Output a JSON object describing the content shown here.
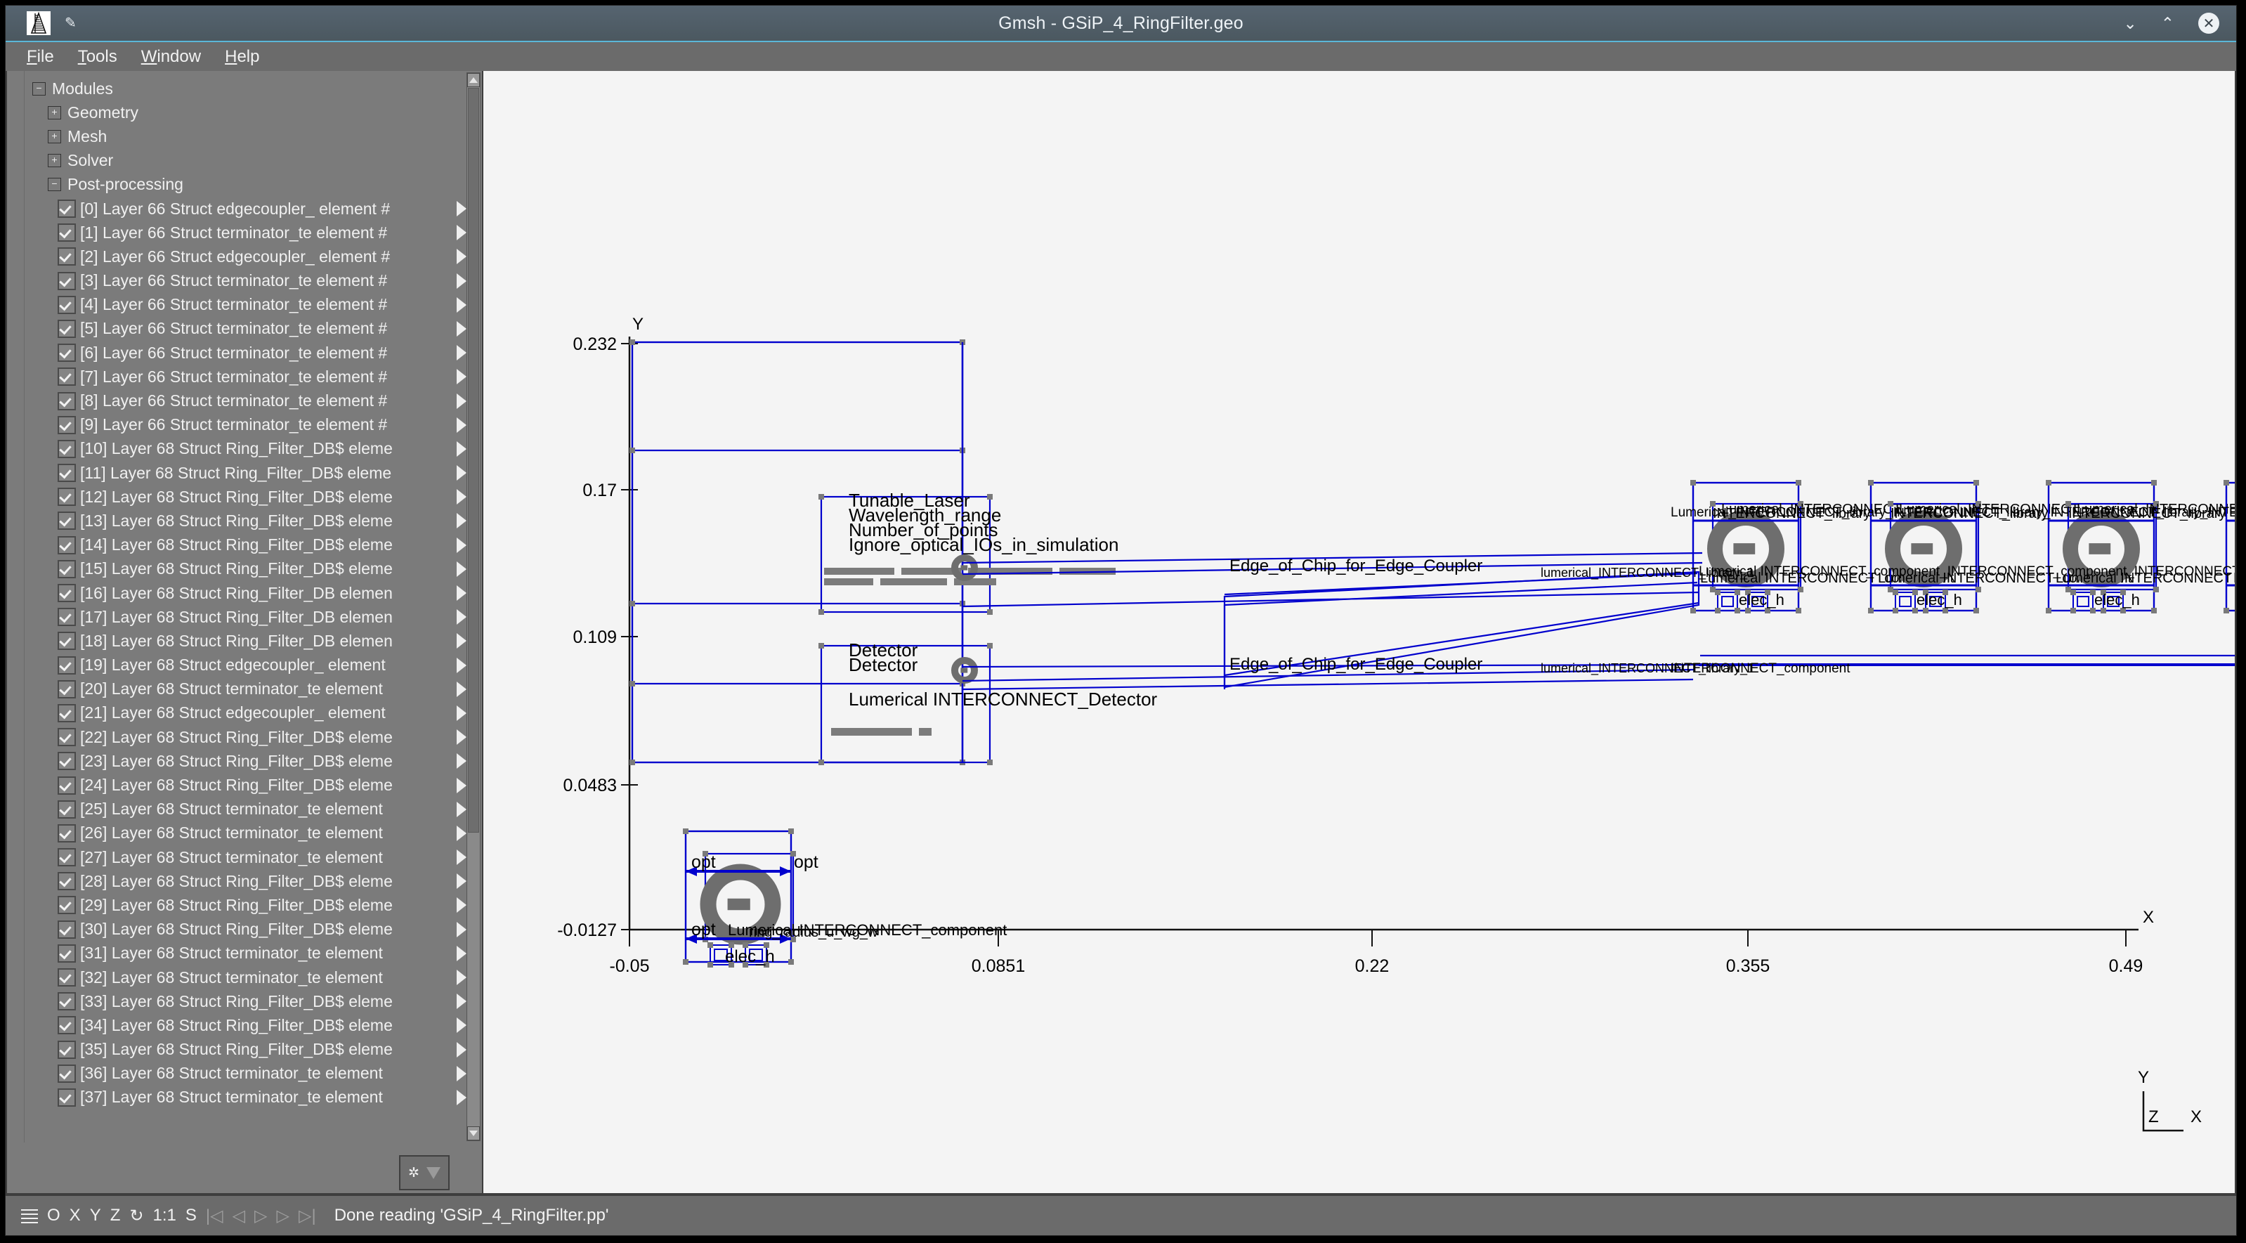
{
  "window": {
    "title": "Gmsh - GSiP_4_RingFilter.geo",
    "logo_icon": "gmsh-logo-icon",
    "pin_icon": "pin-icon",
    "minimize_icon": "chevron-down-icon",
    "maximize_icon": "chevron-up-icon",
    "close_icon": "close-icon",
    "accent_color": "#5bb6d8",
    "titlebar_color": "#4d5a63"
  },
  "menubar": {
    "items": [
      {
        "label": "File",
        "mnemonic": "F"
      },
      {
        "label": "Tools",
        "mnemonic": "T"
      },
      {
        "label": "Window",
        "mnemonic": "W"
      },
      {
        "label": "Help",
        "mnemonic": "H"
      }
    ]
  },
  "sidebar": {
    "root": {
      "label": "Modules",
      "expanded": true
    },
    "modules": [
      {
        "label": "Geometry",
        "expanded": false
      },
      {
        "label": "Mesh",
        "expanded": false
      },
      {
        "label": "Solver",
        "expanded": false
      },
      {
        "label": "Post-processing",
        "expanded": true
      }
    ],
    "views": [
      {
        "index": "[0]",
        "label": "[0] Layer 66 Struct edgecoupler_ element #",
        "checked": true
      },
      {
        "index": "[1]",
        "label": "[1] Layer 66 Struct terminator_te element #",
        "checked": true
      },
      {
        "index": "[2]",
        "label": "[2] Layer 66 Struct edgecoupler_ element #",
        "checked": true
      },
      {
        "index": "[3]",
        "label": "[3] Layer 66 Struct terminator_te element #",
        "checked": true
      },
      {
        "index": "[4]",
        "label": "[4] Layer 66 Struct terminator_te element #",
        "checked": true
      },
      {
        "index": "[5]",
        "label": "[5] Layer 66 Struct terminator_te element #",
        "checked": true
      },
      {
        "index": "[6]",
        "label": "[6] Layer 66 Struct terminator_te element #",
        "checked": true
      },
      {
        "index": "[7]",
        "label": "[7] Layer 66 Struct terminator_te element #",
        "checked": true
      },
      {
        "index": "[8]",
        "label": "[8] Layer 66 Struct terminator_te element #",
        "checked": true
      },
      {
        "index": "[9]",
        "label": "[9] Layer 66 Struct terminator_te element #",
        "checked": true
      },
      {
        "index": "[10]",
        "label": "[10] Layer 68 Struct Ring_Filter_DB$ eleme",
        "checked": true
      },
      {
        "index": "[11]",
        "label": "[11] Layer 68 Struct Ring_Filter_DB$ eleme",
        "checked": true
      },
      {
        "index": "[12]",
        "label": "[12] Layer 68 Struct Ring_Filter_DB$ eleme",
        "checked": true
      },
      {
        "index": "[13]",
        "label": "[13] Layer 68 Struct Ring_Filter_DB$ eleme",
        "checked": true
      },
      {
        "index": "[14]",
        "label": "[14] Layer 68 Struct Ring_Filter_DB$ eleme",
        "checked": true
      },
      {
        "index": "[15]",
        "label": "[15] Layer 68 Struct Ring_Filter_DB$ eleme",
        "checked": true
      },
      {
        "index": "[16]",
        "label": "[16] Layer 68 Struct Ring_Filter_DB elemen",
        "checked": true
      },
      {
        "index": "[17]",
        "label": "[17] Layer 68 Struct Ring_Filter_DB elemen",
        "checked": true
      },
      {
        "index": "[18]",
        "label": "[18] Layer 68 Struct Ring_Filter_DB elemen",
        "checked": true
      },
      {
        "index": "[19]",
        "label": "[19] Layer 68 Struct edgecoupler_ element",
        "checked": true
      },
      {
        "index": "[20]",
        "label": "[20] Layer 68 Struct terminator_te element",
        "checked": true
      },
      {
        "index": "[21]",
        "label": "[21] Layer 68 Struct edgecoupler_ element",
        "checked": true
      },
      {
        "index": "[22]",
        "label": "[22] Layer 68 Struct Ring_Filter_DB$ eleme",
        "checked": true
      },
      {
        "index": "[23]",
        "label": "[23] Layer 68 Struct Ring_Filter_DB$ eleme",
        "checked": true
      },
      {
        "index": "[24]",
        "label": "[24] Layer 68 Struct Ring_Filter_DB$ eleme",
        "checked": true
      },
      {
        "index": "[25]",
        "label": "[25] Layer 68 Struct terminator_te element",
        "checked": true
      },
      {
        "index": "[26]",
        "label": "[26] Layer 68 Struct terminator_te element",
        "checked": true
      },
      {
        "index": "[27]",
        "label": "[27] Layer 68 Struct terminator_te element",
        "checked": true
      },
      {
        "index": "[28]",
        "label": "[28] Layer 68 Struct Ring_Filter_DB$ eleme",
        "checked": true
      },
      {
        "index": "[29]",
        "label": "[29] Layer 68 Struct Ring_Filter_DB$ eleme",
        "checked": true
      },
      {
        "index": "[30]",
        "label": "[30] Layer 68 Struct Ring_Filter_DB$ eleme",
        "checked": true
      },
      {
        "index": "[31]",
        "label": "[31] Layer 68 Struct terminator_te element",
        "checked": true
      },
      {
        "index": "[32]",
        "label": "[32] Layer 68 Struct terminator_te element",
        "checked": true
      },
      {
        "index": "[33]",
        "label": "[33] Layer 68 Struct Ring_Filter_DB$ eleme",
        "checked": true
      },
      {
        "index": "[34]",
        "label": "[34] Layer 68 Struct Ring_Filter_DB$ eleme",
        "checked": true
      },
      {
        "index": "[35]",
        "label": "[35] Layer 68 Struct Ring_Filter_DB$ eleme",
        "checked": true
      },
      {
        "index": "[36]",
        "label": "[36] Layer 68 Struct terminator_te element",
        "checked": true
      },
      {
        "index": "[37]",
        "label": "[37] Layer 68 Struct terminator_te element",
        "checked": true
      }
    ],
    "options_button": {
      "gear_icon": "gear-icon",
      "menu_icon": "triangle-down-icon"
    },
    "scrollbar": {
      "up_icon": "scroll-up-arrow-icon",
      "down_icon": "scroll-down-arrow-icon"
    }
  },
  "statusbar": {
    "menu_icon": "hamburger-icon",
    "buttons": [
      "O",
      "X",
      "Y",
      "Z"
    ],
    "rotate_icon": "rotate-icon",
    "scale": "1:1",
    "stop_label": "S",
    "nav_icons": [
      "skip-first-icon",
      "step-back-icon",
      "play-icon",
      "step-forward-icon",
      "skip-last-icon"
    ],
    "message": "Done reading 'GSiP_4_RingFilter.pp'"
  },
  "chart_data": {
    "type": "scatter",
    "title": "",
    "xlabel": "X",
    "ylabel": "Y",
    "grid": false,
    "xticks": [
      "-0.05",
      "0.0851",
      "0.22",
      "0.355",
      "0.49"
    ],
    "yticks": [
      "-0.0127",
      "0.0483",
      "0.109",
      "0.17",
      "0.232"
    ],
    "xlim": [
      -0.05,
      0.49
    ],
    "ylim": [
      -0.0127,
      0.232
    ],
    "axis_triad": {
      "y": "Y",
      "z": "Z",
      "x": "X"
    },
    "annotations": [
      {
        "text": "Tunable_Laser",
        "x": 0.955,
        "y": 0.612
      },
      {
        "text": "Wavelength_range",
        "x": 0.955,
        "y": 0.624
      },
      {
        "text": "Number_of_points",
        "x": 0.955,
        "y": 0.636
      },
      {
        "text": "Ignore_optical_IOs_in_simulation",
        "x": 0.955,
        "y": 0.648
      },
      {
        "text": "Edge_of_Chip_for_Edge_Coupler",
        "x": 1.045,
        "y": 0.704
      },
      {
        "text": "Detector",
        "x": 0.955,
        "y": 0.824
      },
      {
        "text": "Detector",
        "x": 0.955,
        "y": 0.836
      },
      {
        "text": "Lumerical INTERCONNECT_Detector",
        "x": 1.045,
        "y": 0.877
      },
      {
        "text": "Lumerical INTERCONNECT_component",
        "x": 1.155,
        "y": 1.308
      },
      {
        "text": "INTERCONNECT_library",
        "x": 1.66,
        "y": 0.624
      },
      {
        "text": "INTERCONNECT_component",
        "x": 1.66,
        "y": 0.704
      },
      {
        "text": "opt",
        "x": 1.01,
        "y": 1.232
      },
      {
        "text": "opt",
        "x": 1.155,
        "y": 1.232
      },
      {
        "text": "opt",
        "x": 1.01,
        "y": 1.308
      },
      {
        "text": "elec_h",
        "x": 1.12,
        "y": 1.333
      }
    ],
    "geometry_color": "#0000cd",
    "text_color": "#000000",
    "background": "#f4f4f4"
  }
}
